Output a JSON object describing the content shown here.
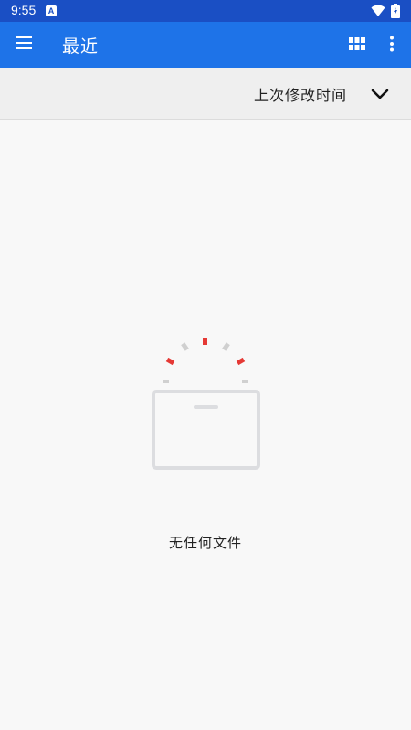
{
  "status_bar": {
    "time": "9:55",
    "notification_icon": "a-icon",
    "wifi_icon": "wifi-icon",
    "battery_icon": "battery-icon"
  },
  "app_bar": {
    "title": "最近",
    "menu_icon": "hamburger-menu-icon",
    "grid_icon": "grid-view-icon",
    "more_icon": "more-vert-icon",
    "color": "#1e73e8"
  },
  "sort_bar": {
    "label": "上次修改时间",
    "chevron_icon": "chevron-down-icon"
  },
  "empty_state": {
    "illustration_icon": "empty-folder-icon",
    "message": "无任何文件"
  },
  "colors": {
    "status_bar": "#1a4fc4",
    "accent": "#1e73e8",
    "sparkle_red": "#e53935",
    "sparkle_gray": "#d0d0d0"
  }
}
